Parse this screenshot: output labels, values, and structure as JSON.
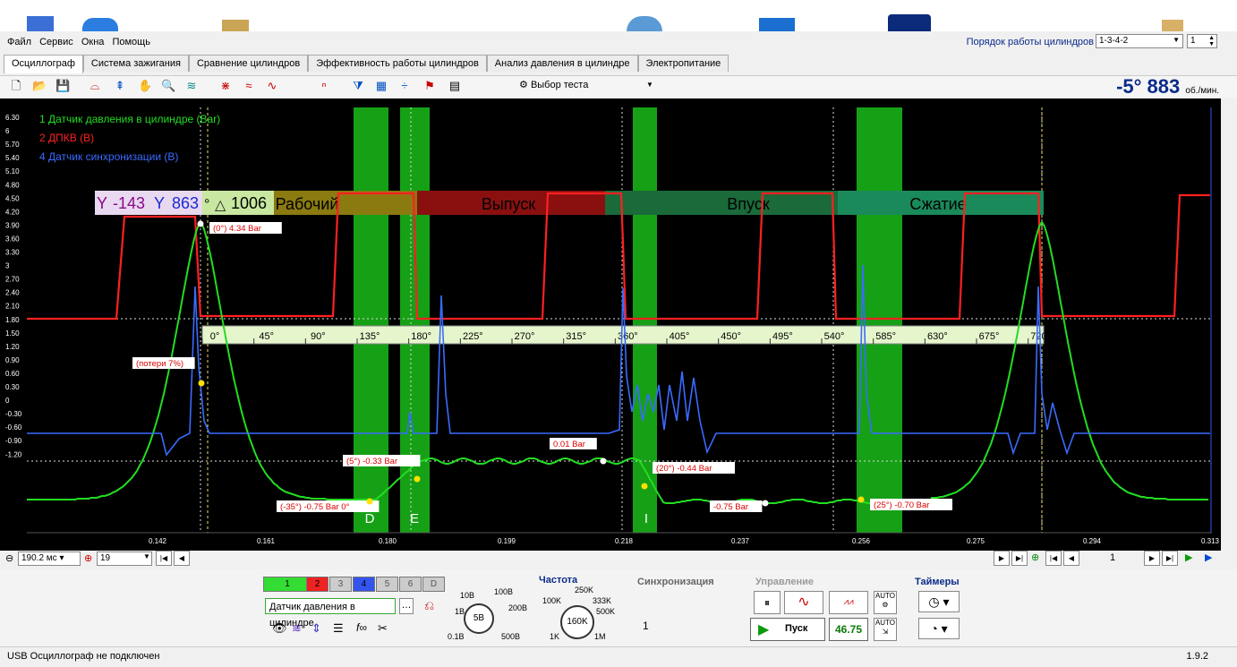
{
  "menu": [
    "Файл",
    "Сервис",
    "Окна",
    "Помощь"
  ],
  "cylinder_order": {
    "label": "Порядок работы цилиндров",
    "value": "1-3-4-2",
    "count": "1"
  },
  "tabs": [
    "Осциллограф",
    "Система зажигания",
    "Сравнение цилиндров",
    "Эффективность работы цилиндров",
    "Анализ давления в цилиндре",
    "Электропитание"
  ],
  "toolbar": {
    "test_select": "Выбор теста"
  },
  "rpm": {
    "angle": "-5°",
    "value": "883",
    "unit": "об./мин."
  },
  "legend": [
    {
      "label": "1 Датчик давления в цилиндре (Bar)",
      "color": "#22dd22"
    },
    {
      "label": "2 ДПКВ (В)",
      "color": "#ff2020"
    },
    {
      "label": "4 Датчик синхронизации (В)",
      "color": "#3a6bff"
    }
  ],
  "y_ticks": [
    "6.30",
    "6",
    "5.70",
    "5.40",
    "5.10",
    "4.80",
    "4.50",
    "4.20",
    "3.90",
    "3.60",
    "3.30",
    "3",
    "2.70",
    "2.40",
    "2.10",
    "1.80",
    "1.50",
    "1.20",
    "0.90",
    "0.60",
    "0.30",
    "0",
    "-0.30",
    "-0.60",
    "-0.90",
    "-1.20"
  ],
  "x_ticks": [
    "0.142",
    "0.161",
    "0.180",
    "0.199",
    "0.218",
    "0.237",
    "0.256",
    "0.275",
    "0.294",
    "0.313"
  ],
  "angle_ticks": [
    "0°",
    "45°",
    "90°",
    "135°",
    "180°",
    "225°",
    "270°",
    "315°",
    "360°",
    "405°",
    "450°",
    "495°",
    "540°",
    "585°",
    "630°",
    "675°",
    "720°"
  ],
  "phases": [
    "Рабочий",
    "Выпуск",
    "Впуск",
    "Сжатие"
  ],
  "cursor": {
    "a": "-143",
    "b": "863",
    "unit": "°",
    "delta": "1006"
  },
  "markers": [
    "D",
    "E",
    "I"
  ],
  "annotations": [
    {
      "text": "(0°) 4.34 Bar"
    },
    {
      "text": "(потери 7%)"
    },
    {
      "text": "(-35°) -0.75 Bar 0°"
    },
    {
      "text": "(5°) -0.33 Bar"
    },
    {
      "text": "0.01 Bar"
    },
    {
      "text": "(20°) -0.44 Bar"
    },
    {
      "text": "-0.75 Bar"
    },
    {
      "text": "(25°) -0.70 Bar"
    }
  ],
  "timebase": {
    "value": "190.2 мс",
    "trigger": "19"
  },
  "page_counter": "1",
  "channels": [
    "1",
    "2",
    "3",
    "4",
    "5",
    "6",
    "D"
  ],
  "channel_select": "Датчик давления в цилиндре",
  "range": {
    "value": "5В",
    "labels": [
      "10В",
      "100В",
      "1В",
      "200В",
      "0.1В",
      "500В"
    ]
  },
  "frequency": {
    "title": "Частота",
    "value": "160K",
    "labels": [
      "250K",
      "100K",
      "333K",
      "500K",
      "1K",
      "1M"
    ]
  },
  "sync": {
    "title": "Синхронизация",
    "value": "1"
  },
  "control": {
    "title": "Управление",
    "start": "Пуск",
    "value": "46.75"
  },
  "timers": {
    "title": "Таймеры"
  },
  "status": {
    "text": "USB Осциллограф не подключен",
    "version": "1.9.2"
  }
}
